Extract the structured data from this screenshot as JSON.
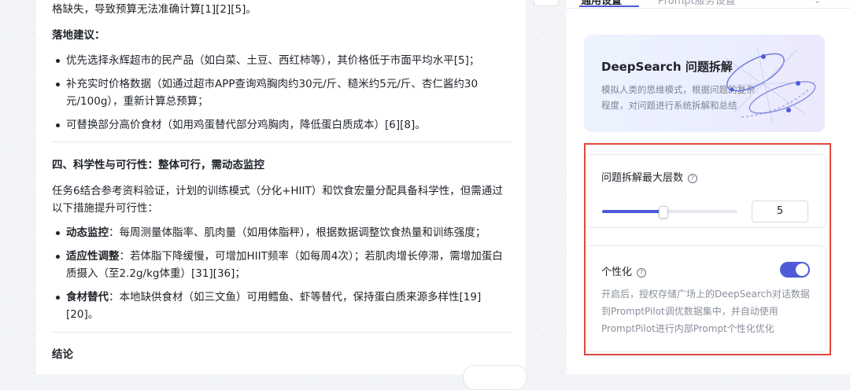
{
  "article": {
    "line_top": "格缺失，导致预算无法准确计算[1][2][5]。",
    "section_suggestions_title": "落地建议：",
    "suggestions": [
      "优先选择永辉超市的民产品（如白菜、土豆、西红柿等），其价格低于市面平均水平[5]；",
      "补充实时价格数据（如通过超市APP查询鸡胸肉约30元/斤、糙米约5元/斤、杏仁酱约30元/100g），重新计算总预算；",
      "可替换部分高价食材（如用鸡蛋替代部分鸡胸肉，降低蛋白质成本）[6][8]。"
    ],
    "section4_title": "四、科学性与可行性：整体可行，需动态监控",
    "section4_intro": "任务6结合参考资料验证，计划的训练模式（分化+HIIT）和饮食宏量分配具备科学性，但需通过以下措施提升可行性：",
    "measures": [
      {
        "label": "动态监控",
        "text": "：每周测量体脂率、肌肉量（如用体脂秤），根据数据调整饮食热量和训练强度；"
      },
      {
        "label": "适应性调整",
        "text": "：若体脂下降缓慢，可增加HIIT频率（如每周4次）；若肌肉增长停滞，需增加蛋白质摄入（至2.2g/kg体重）[31][36]；"
      },
      {
        "label": "食材替代",
        "text": "：本地缺供食材（如三文鱼）可用鳕鱼、虾等替代，保持蛋白质来源多样性[19][20]。"
      }
    ],
    "conclusion_title": "结论"
  },
  "sidebar": {
    "tabs": [
      "通用设置",
      "Prompt服务设置"
    ],
    "card": {
      "title": "DeepSearch 问题拆解",
      "description": "模拟人类的思维模式，根据问题的复杂程度，对问题进行系统拆解和总结"
    },
    "max_depth": {
      "label": "问题拆解最大层数",
      "value": "5",
      "level": 0.45
    },
    "personalization": {
      "label": "个性化",
      "enabled": true,
      "description": "开启后，授权存储广场上的DeepSearch对话数据到PromptPilot调优数据集中，并自动使用PromptPilot进行内部Prompt个性化优化"
    },
    "colors": {
      "accent": "#4e5bd9",
      "highlight": "#e2463b"
    }
  }
}
